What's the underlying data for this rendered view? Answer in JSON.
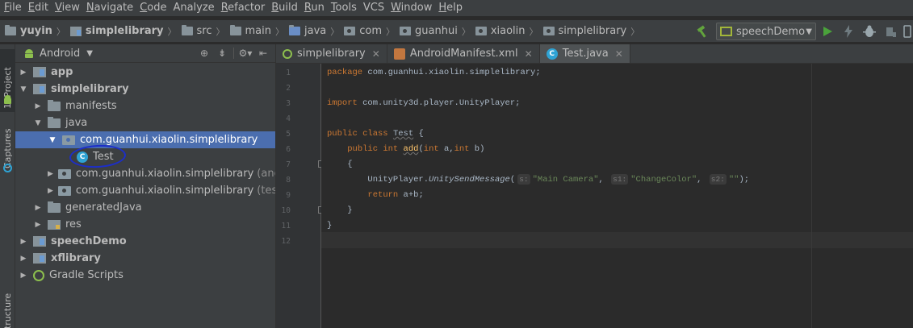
{
  "menu": [
    {
      "u": "F",
      "rest": "ile"
    },
    {
      "u": "E",
      "rest": "dit"
    },
    {
      "u": "V",
      "rest": "iew"
    },
    {
      "u": "N",
      "rest": "avigate"
    },
    {
      "u": "C",
      "rest": "ode"
    },
    {
      "u": "",
      "rest": "Analyze"
    },
    {
      "u": "R",
      "rest": "efactor"
    },
    {
      "u": "B",
      "rest": "uild"
    },
    {
      "u": "R",
      "rest": "un"
    },
    {
      "u": "T",
      "rest": "ools"
    },
    {
      "u": "",
      "rest": "VCS"
    },
    {
      "u": "W",
      "rest": "indow"
    },
    {
      "u": "H",
      "rest": "elp"
    }
  ],
  "breadcrumb": [
    "yuyin",
    "simplelibrary",
    "src",
    "main",
    "java",
    "com",
    "guanhui",
    "xiaolin",
    "simplelibrary"
  ],
  "run_config": "speechDemo",
  "project": {
    "view": "Android",
    "side_tabs": [
      "1: Project",
      "Captures",
      "Structure"
    ],
    "tree": [
      {
        "label": "app",
        "bold": true,
        "suffix": ""
      },
      {
        "label": "simplelibrary",
        "bold": true,
        "suffix": ""
      },
      {
        "label": "manifests",
        "bold": false,
        "suffix": ""
      },
      {
        "label": "java",
        "bold": false,
        "suffix": ""
      },
      {
        "label": "com.guanhui.xiaolin.simplelibrary",
        "bold": false,
        "suffix": ""
      },
      {
        "label": "Test",
        "bold": false,
        "suffix": ""
      },
      {
        "label": "com.guanhui.xiaolin.simplelibrary",
        "bold": false,
        "suffix": "(android"
      },
      {
        "label": "com.guanhui.xiaolin.simplelibrary",
        "bold": false,
        "suffix": "(test)"
      },
      {
        "label": "generatedJava",
        "bold": false,
        "suffix": ""
      },
      {
        "label": "res",
        "bold": false,
        "suffix": ""
      },
      {
        "label": "speechDemo",
        "bold": true,
        "suffix": ""
      },
      {
        "label": "xflibrary",
        "bold": true,
        "suffix": ""
      },
      {
        "label": "Gradle Scripts",
        "bold": false,
        "suffix": ""
      }
    ]
  },
  "tabs": [
    {
      "label": "simplelibrary"
    },
    {
      "label": "AndroidManifest.xml"
    },
    {
      "label": "Test.java"
    }
  ],
  "editor": {
    "line_numbers": [
      "1",
      "2",
      "3",
      "4",
      "5",
      "6",
      "7",
      "8",
      "9",
      "10",
      "11",
      "12"
    ],
    "l1_kw": "package",
    "l1_rest": " com.guanhui.xiaolin.simplelibrary;",
    "l3_kw": "import",
    "l3_rest": " com.unity3d.player.UnityPlayer;",
    "l5_kw": "public class",
    "l5_name": "Test",
    "l5_rest": " {",
    "l6_kw": "public int",
    "l6_name": "add",
    "l6_p1kw": "int",
    "l6_p1": " a,",
    "l6_p2kw": "int",
    "l6_p2": " b)",
    "l7": "{",
    "l8_obj": "UnityPlayer.",
    "l8_method": "UnitySendMessage",
    "l8_h1": "s:",
    "l8_s1": "\"Main Camera\"",
    "l8_h2": "s1:",
    "l8_s2": "\"ChangeColor\"",
    "l8_h3": "s2:",
    "l8_s3": "\"\"",
    "l8_end": ");",
    "l9_kw": "return",
    "l9_rest": " a+b;",
    "l10": "}",
    "l11": "}"
  }
}
